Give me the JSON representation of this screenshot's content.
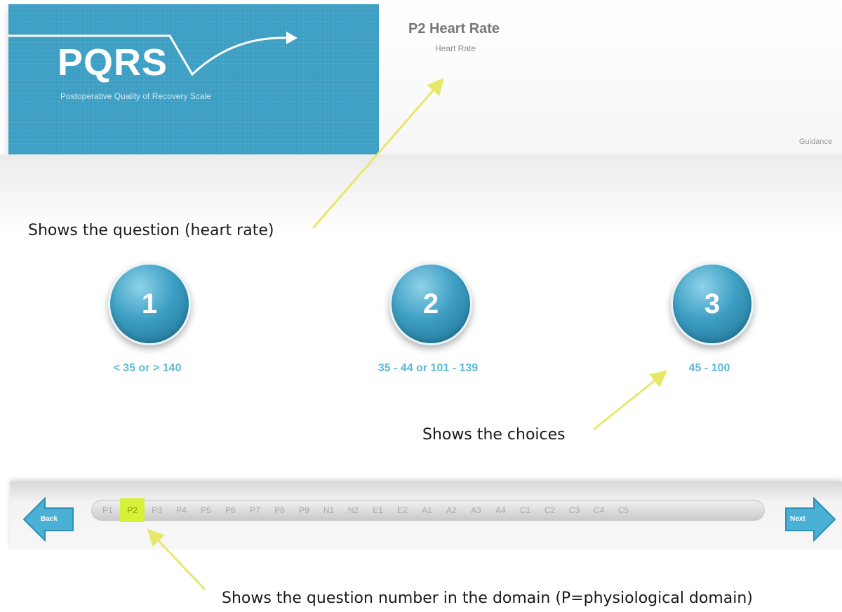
{
  "logo": {
    "title": "PQRS",
    "subtitle": "Postoperative Quality of Recovery Scale"
  },
  "question": {
    "title": "P2 Heart Rate",
    "subtitle": "Heart Rate",
    "guidance_label": "Guidance"
  },
  "annotations": {
    "question_note": "Shows the question (heart rate)",
    "choices_note": "Shows the choices",
    "domain_note": "Shows the question number in the domain (P=physiological domain)"
  },
  "choices": [
    {
      "number": "1",
      "label": "< 35 or > 140"
    },
    {
      "number": "2",
      "label": "35 - 44 or 101 - 139"
    },
    {
      "number": "3",
      "label": "45 - 100"
    }
  ],
  "nav": {
    "back_label": "Back",
    "next_label": "Next",
    "active_index": 1,
    "questions": [
      "P1",
      "P2",
      "P3",
      "P4",
      "P5",
      "P6",
      "P7",
      "P8",
      "P9",
      "N1",
      "N2",
      "E1",
      "E2",
      "A1",
      "A2",
      "A3",
      "A4",
      "C1",
      "C2",
      "C3",
      "C4",
      "C5"
    ]
  },
  "colors": {
    "brand_blue": "#3d9fc3",
    "choice_text": "#5fb8d8",
    "highlight": "#d7f03a",
    "annotation_arrow": "#e6e86a"
  }
}
